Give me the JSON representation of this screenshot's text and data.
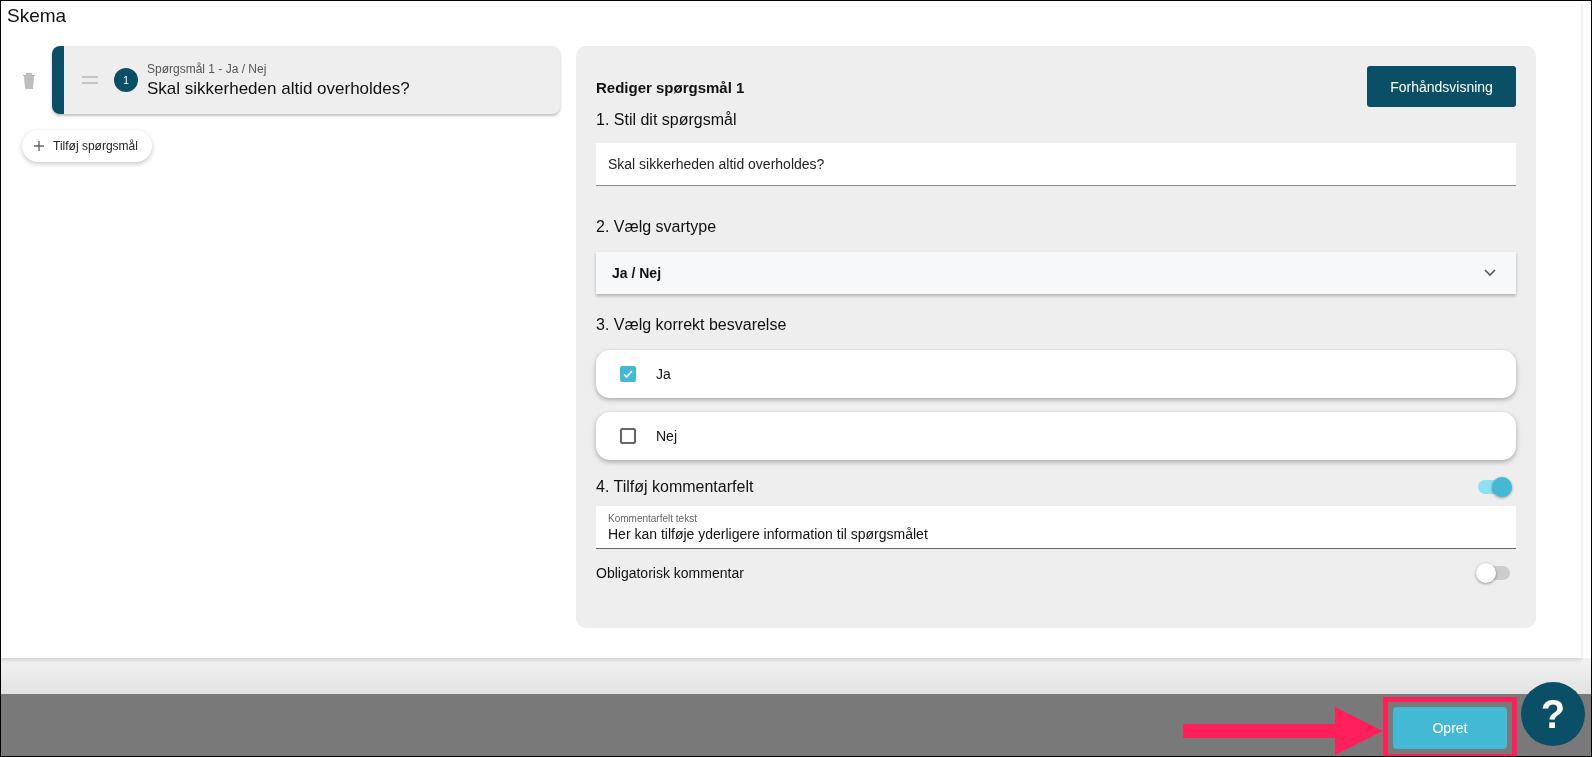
{
  "title": "Skema",
  "questions": [
    {
      "number": "1",
      "subtitle": "Spørgsmål 1 - Ja / Nej",
      "text": "Skal sikkerheden altid overholdes?",
      "selected": true
    }
  ],
  "add_question": "Tilføj spørgsmål",
  "editor": {
    "heading": "Rediger spørgsmål 1",
    "preview_button": "Forhåndsvisning",
    "step1_label": "1. Stil dit spørgsmål",
    "question_value": "Skal sikkerheden altid overholdes?",
    "step2_label": "2. Vælg svartype",
    "answer_type": "Ja / Nej",
    "step3_label": "3. Vælg korrekt besvarelse",
    "options": [
      {
        "label": "Ja",
        "checked": true
      },
      {
        "label": "Nej",
        "checked": false
      }
    ],
    "step4_label": "4. Tilføj kommentarfelt",
    "comment_on": true,
    "comment_field": {
      "label": "Kommentarfelt tekst",
      "value": "Her kan tilføje yderligere information til spørgsmålet"
    },
    "mandatory": {
      "label": "Obligatorisk kommentar",
      "on": false
    }
  },
  "footer": {
    "create_button": "Opret",
    "create_highlighted": true,
    "help": "?"
  }
}
